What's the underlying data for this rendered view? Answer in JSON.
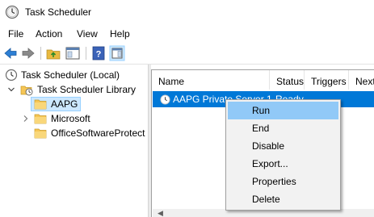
{
  "window": {
    "title": "Task Scheduler",
    "icon": "clock-icon"
  },
  "menu": [
    "File",
    "Action",
    "View",
    "Help"
  ],
  "toolbar": {
    "buttons": [
      "back-arrow-icon",
      "forward-arrow-icon",
      "up-folder-icon",
      "show-hide-tree-icon",
      "help-icon",
      "show-hide-action-pane-icon"
    ]
  },
  "tree": {
    "root": "Task Scheduler (Local)",
    "library": "Task Scheduler Library",
    "items": [
      "AAPG",
      "Microsoft",
      "OfficeSoftwareProtect"
    ],
    "selected": "AAPG"
  },
  "list": {
    "columns": [
      "Name",
      "Status",
      "Triggers",
      "Next"
    ],
    "rows": [
      {
        "name": "AAPG Private Server 1",
        "status": "Ready"
      }
    ]
  },
  "context_menu": {
    "items": [
      "Run",
      "End",
      "Disable",
      "Export...",
      "Properties",
      "Delete"
    ],
    "highlighted": "Run"
  },
  "colors": {
    "selection": "#0078d7",
    "tree_selection": "#cce8ff",
    "menu_hover": "#91c9f7",
    "folder": "#f6c655"
  }
}
